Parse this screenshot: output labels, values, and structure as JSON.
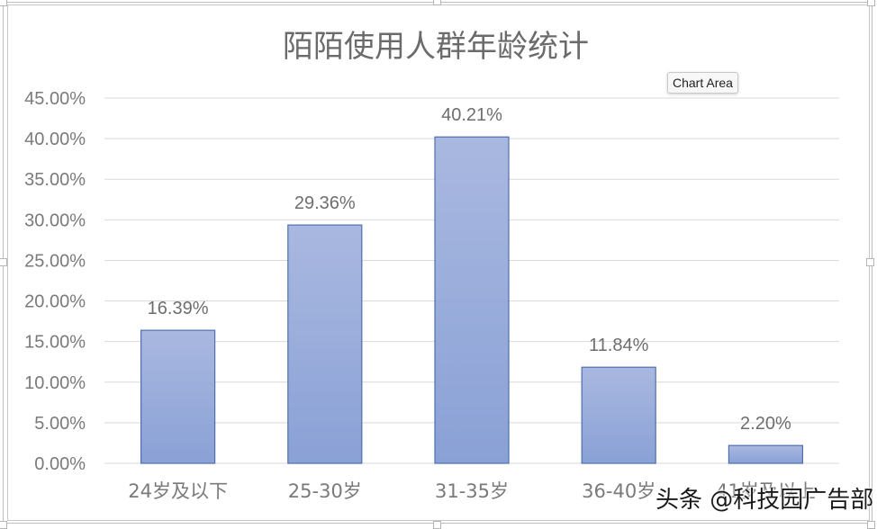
{
  "chart_data": {
    "type": "bar",
    "title": "陌陌使用人群年龄统计",
    "categories": [
      "24岁及以下",
      "25-30岁",
      "31-35岁",
      "36-40岁",
      "41岁及以上"
    ],
    "values": [
      16.39,
      29.36,
      40.21,
      11.84,
      2.2
    ],
    "data_labels": [
      "16.39%",
      "29.36%",
      "40.21%",
      "11.84%",
      "2.20%"
    ],
    "xlabel": "",
    "ylabel": "",
    "ylim": [
      0,
      45
    ],
    "y_ticks": [
      0,
      5,
      10,
      15,
      20,
      25,
      30,
      35,
      40,
      45
    ],
    "y_tick_labels": [
      "0.00%",
      "5.00%",
      "10.00%",
      "15.00%",
      "20.00%",
      "25.00%",
      "30.00%",
      "35.00%",
      "40.00%",
      "45.00%"
    ],
    "grid": true,
    "legend": "none",
    "bar_color_top": "#a9b8e0",
    "bar_color_bottom": "#8aa1d6",
    "bar_border_color": "#4f6fae"
  },
  "ui": {
    "tooltip": "Chart Area",
    "watermark": "头条 @科技园广告部"
  }
}
